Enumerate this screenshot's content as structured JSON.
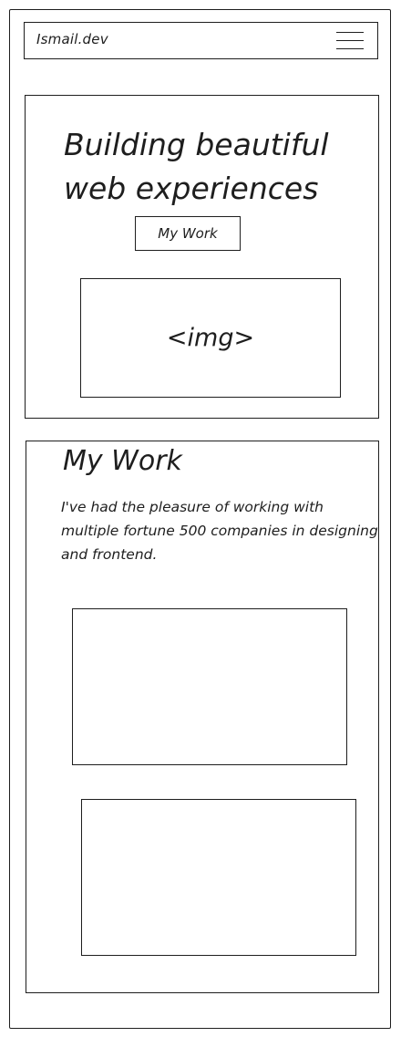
{
  "header": {
    "brand": "Ismail.dev",
    "menu_icon": "hamburger-menu-icon"
  },
  "hero": {
    "title": "Building beautiful web experiences",
    "cta_label": "My Work",
    "image_placeholder": "<img>"
  },
  "work": {
    "title": "My Work",
    "description": "I've had the pleasure of working with multiple fortune 500 companies in designing and frontend.",
    "cards": [
      "project-card",
      "project-card"
    ]
  }
}
